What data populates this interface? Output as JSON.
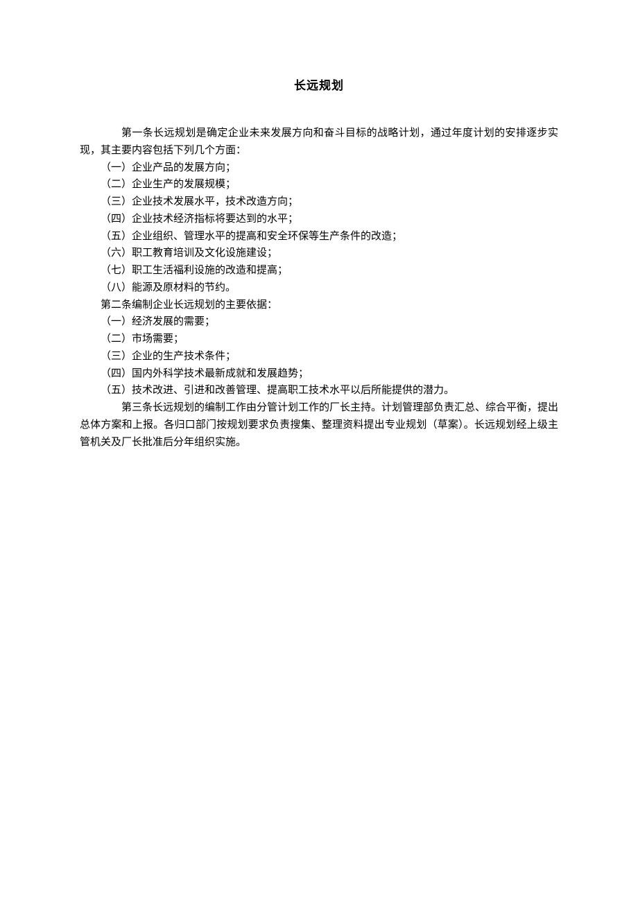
{
  "title": "长远规划",
  "article1": {
    "intro": "第一条长远规划是确定企业未来发展方向和奋斗目标的战略计划，通过年度计划的安排逐步实现，其主要内容包括下列几个方面：",
    "items": [
      "（一）企业产品的发展方向；",
      "（二）企业生产的发展规模；",
      "（三）企业技术发展水平，技术改造方向；",
      "（四）企业技术经济指标将要达到的水平；",
      "（五）企业组织、管理水平的提高和安全环保等生产条件的改造；",
      "（六）职工教育培训及文化设施建设；",
      "（七）职工生活福利设施的改造和提高；",
      "（八）能源及原材料的节约。"
    ]
  },
  "article2": {
    "intro": "第二条编制企业长远规划的主要依据：",
    "items": [
      "（一）经济发展的需要；",
      "（二）市场需要；",
      "（三）企业的生产技术条件；",
      "（四）国内外科学技术最新成就和发展趋势；",
      "（五）技术改进、引进和改善管理、提高职工技术水平以后所能提供的潜力。"
    ]
  },
  "article3": {
    "text": "第三条长远规划的编制工作由分管计划工作的厂长主持。计划管理部负责汇总、综合平衡，提出总体方案和上报。各归口部门按规划要求负责搜集、整理资料提出专业规划（草案）。长远规划经上级主管机关及厂长批准后分年组织实施。"
  }
}
